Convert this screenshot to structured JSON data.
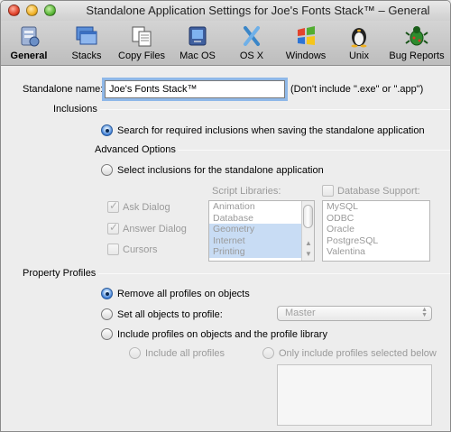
{
  "window": {
    "title": "Standalone Application Settings for Joe's Fonts Stack™ – General"
  },
  "toolbar": {
    "items": [
      {
        "label": "General",
        "icon": "general-icon",
        "active": true
      },
      {
        "label": "Stacks",
        "icon": "stacks-icon"
      },
      {
        "label": "Copy Files",
        "icon": "copy-files-icon"
      },
      {
        "label": "Mac OS",
        "icon": "mac-os-icon"
      },
      {
        "label": "OS X",
        "icon": "os-x-icon"
      },
      {
        "label": "Windows",
        "icon": "windows-icon"
      },
      {
        "label": "Unix",
        "icon": "unix-icon"
      },
      {
        "label": "Bug Reports",
        "icon": "bug-reports-icon"
      }
    ]
  },
  "standalone": {
    "label": "Standalone name:",
    "value": "Joe's Fonts Stack™",
    "hint": "(Don't include \".exe\" or \".app\")"
  },
  "inclusions": {
    "section": "Inclusions",
    "search_option": "Search for required inclusions when saving the standalone application",
    "advanced_section": "Advanced Options",
    "select_option": "Select inclusions for the standalone application",
    "checkboxes": [
      "Ask Dialog",
      "Answer Dialog",
      "Cursors"
    ],
    "script_libraries_label": "Script Libraries:",
    "script_libraries": [
      "Animation",
      "Database",
      "Geometry",
      "Internet",
      "Printing"
    ],
    "database_support_label": "Database Support:",
    "database_support": [
      "MySQL",
      "ODBC",
      "Oracle",
      "PostgreSQL",
      "Valentina"
    ]
  },
  "profiles": {
    "section": "Property Profiles",
    "remove_option": "Remove all profiles on objects",
    "set_option": "Set all objects to profile:",
    "set_value": "Master",
    "include_option": "Include profiles on objects and the profile library",
    "include_all": "Include all profiles",
    "include_selected": "Only include profiles selected below"
  },
  "colors": {
    "focus_ring": "#8fb8e8",
    "selection": "#c8dcf4",
    "radio_on": "#3a7bd5"
  }
}
